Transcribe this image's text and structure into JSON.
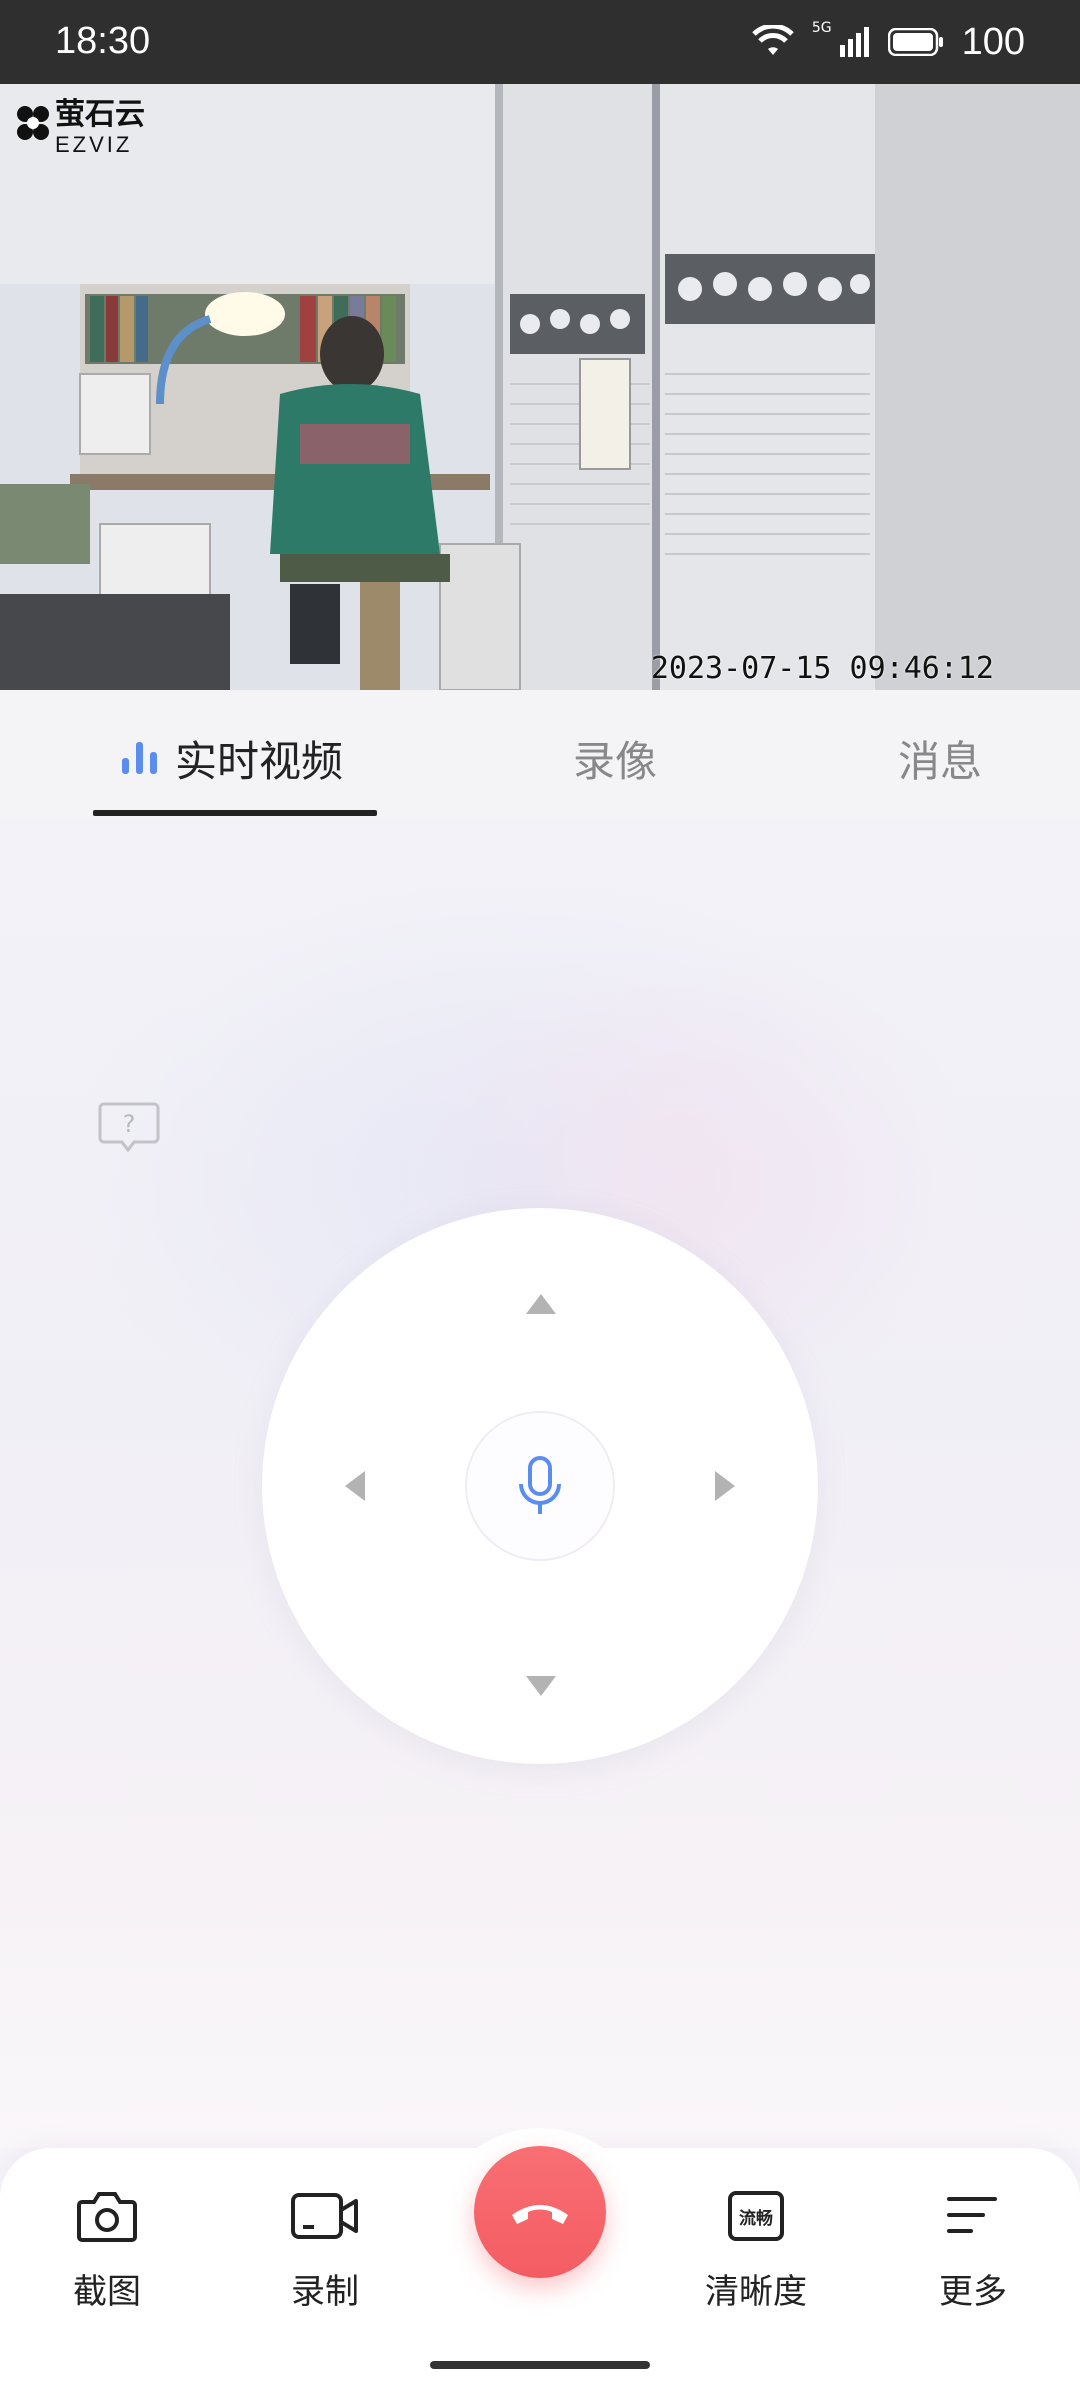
{
  "status_bar": {
    "time": "18:30",
    "network": "5G",
    "battery": "100"
  },
  "video": {
    "brand_cn": "萤石云",
    "brand_en": "EZVIZ",
    "timestamp": "2023-07-15 09:46:12"
  },
  "tabs": {
    "live": "实时视频",
    "recording": "录像",
    "messages": "消息"
  },
  "toolbar": {
    "screenshot": "截图",
    "record": "录制",
    "clarity": "清晰度",
    "clarity_badge": "流畅",
    "more": "更多"
  },
  "colors": {
    "accent_blue": "#5b8def",
    "hangup_red": "#f45c63",
    "statusbar_bg": "#2f2f2f"
  },
  "icons": {
    "help": "help-bubble-icon",
    "mic": "microphone-icon",
    "hangup": "phone-hangup-icon",
    "camera": "camera-icon",
    "video": "video-camera-icon",
    "more": "menu-lines-icon"
  }
}
